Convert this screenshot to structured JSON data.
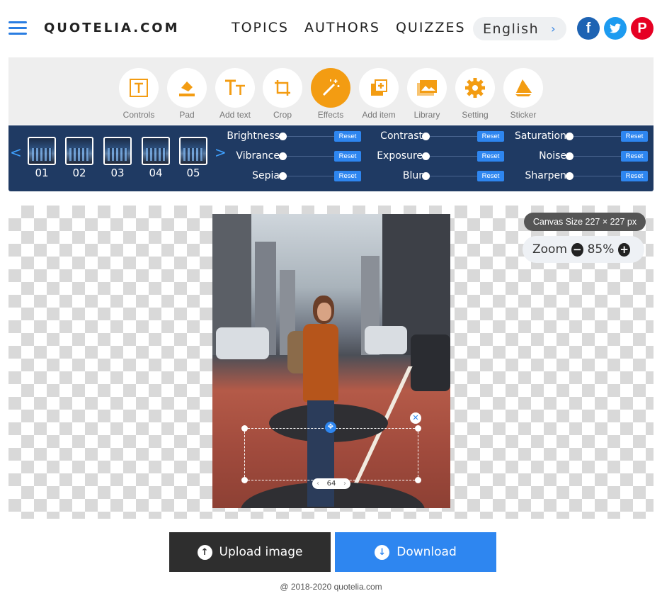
{
  "header": {
    "logo": "QUOTELIA.COM",
    "nav": [
      "TOPICS",
      "AUTHORS",
      "QUIZZES"
    ],
    "language": "English",
    "social": [
      {
        "name": "facebook",
        "glyph": "f",
        "color": "#1e63b3"
      },
      {
        "name": "twitter",
        "glyph": "t",
        "color": "#1d9bf0"
      },
      {
        "name": "pinterest",
        "glyph": "P",
        "color": "#e60023"
      }
    ]
  },
  "toolbar": {
    "tools": [
      {
        "label": "Controls",
        "icon": "text-frame-icon"
      },
      {
        "label": "Pad",
        "icon": "paint-bucket-icon"
      },
      {
        "label": "Add text",
        "icon": "text-size-icon"
      },
      {
        "label": "Crop",
        "icon": "crop-rotate-icon"
      },
      {
        "label": "Effects",
        "icon": "magic-wand-icon",
        "active": true
      },
      {
        "label": "Add item",
        "icon": "add-layer-icon"
      },
      {
        "label": "Library",
        "icon": "image-library-icon"
      },
      {
        "label": "Setting",
        "icon": "gear-icon"
      },
      {
        "label": "Sticker",
        "icon": "sailboat-sticker-icon"
      }
    ],
    "accent_color": "#f39c12"
  },
  "effects": {
    "presets": [
      "01",
      "02",
      "03",
      "04",
      "05"
    ],
    "sliders": [
      {
        "name": "Brightness",
        "reset": "Reset"
      },
      {
        "name": "Contrast",
        "reset": "Reset"
      },
      {
        "name": "Saturation",
        "reset": "Reset"
      },
      {
        "name": "Vibrance",
        "reset": "Reset"
      },
      {
        "name": "Exposure",
        "reset": "Reset"
      },
      {
        "name": "Noise",
        "reset": "Reset"
      },
      {
        "name": "Sepia",
        "reset": "Reset"
      },
      {
        "name": "Blur",
        "reset": "Reset"
      },
      {
        "name": "Sharpen",
        "reset": "Reset"
      }
    ]
  },
  "canvas": {
    "size_label": "Canvas Size 227 × 227 px",
    "zoom_label": "Zoom",
    "zoom_value": "85%",
    "selection_value": "64"
  },
  "actions": {
    "upload": "Upload image",
    "download": "Download"
  },
  "footer": "@ 2018-2020 quotelia.com"
}
